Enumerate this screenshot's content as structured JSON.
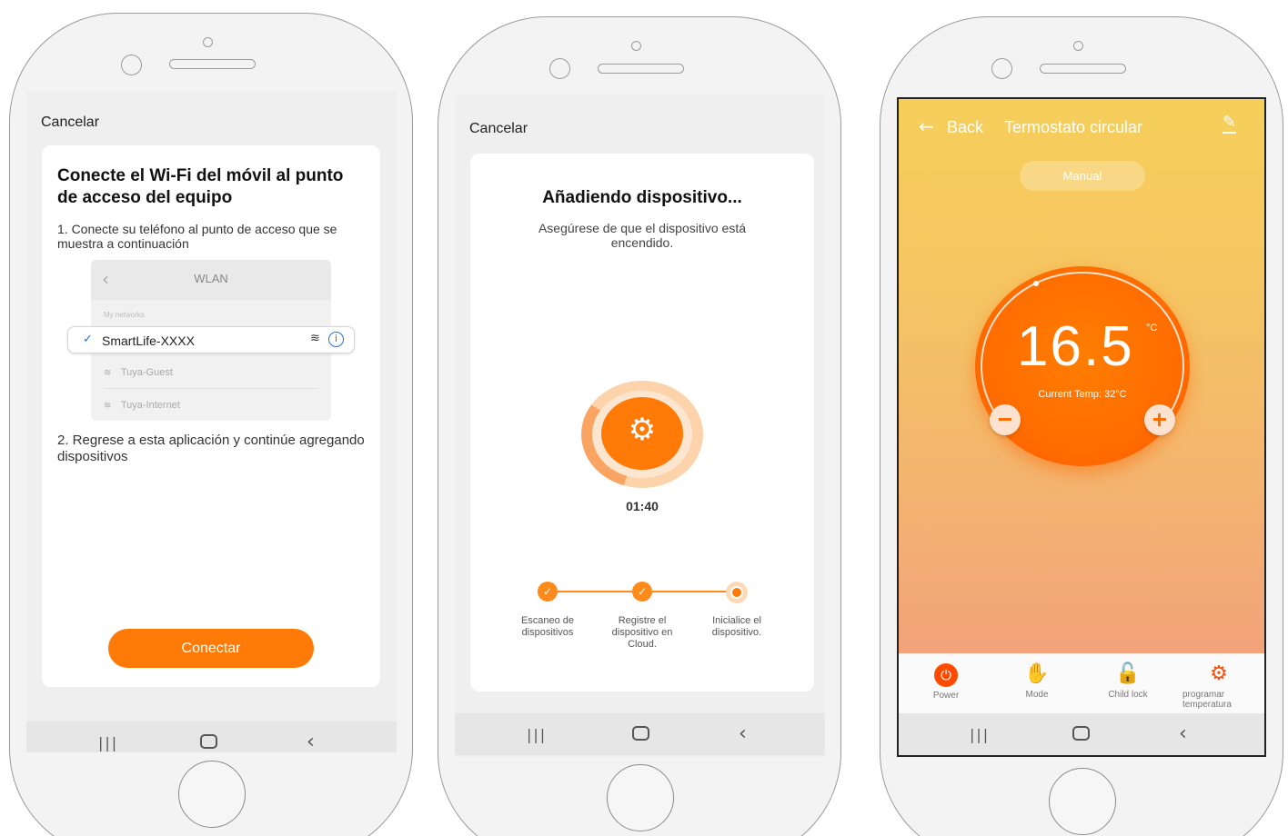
{
  "screen1": {
    "cancel_label": "Cancelar",
    "title": "Conecte el Wi-Fi del móvil al punto de acceso del equipo",
    "step1": "1. Conecte su teléfono al punto de acceso que se muestra a continuación",
    "wlan": {
      "title": "WLAN",
      "section_label": "My networks",
      "selected_network": "SmartLife-XXXX",
      "other_networks": [
        "Tuya-Guest",
        "Tuya-Internet"
      ]
    },
    "step2": "2. Regrese a esta aplicación y continúe agregando dispositivos",
    "connect_button": "Conectar"
  },
  "screen2": {
    "cancel_label": "Cancelar",
    "title": "Añadiendo dispositivo...",
    "subtitle": "Asegúrese de que el dispositivo está encendido.",
    "timer": "01:40",
    "steps": [
      {
        "label": "Escaneo de dispositivos",
        "state": "done"
      },
      {
        "label": "Registre el dispositivo en Cloud.",
        "state": "done"
      },
      {
        "label": "Inicialice el dispositivo.",
        "state": "active"
      }
    ]
  },
  "screen3": {
    "back_label": "Back",
    "title": "Termostato circular",
    "mode_badge": "Manual",
    "set_temp": "16.5",
    "unit": "°C",
    "current_temp": "Current Temp:  32°C",
    "toolbar": {
      "power": "Power",
      "mode": "Mode",
      "child_lock": "Child lock",
      "schedule": "programar temperatura"
    }
  },
  "colors": {
    "accent": "#ff7a06",
    "thermostat_dial": "#ff6d00",
    "thermostat_bg_top": "#f6cf5a",
    "thermostat_bg_bottom": "#f3a27a"
  },
  "icons": {
    "nav": [
      "recent-apps-icon",
      "home-icon",
      "back-icon"
    ],
    "wifi": "wifi-icon",
    "info": "info-icon",
    "gear": "gear-icon",
    "edit": "edit-icon",
    "power": "power-icon",
    "mode": "hand-icon",
    "lock": "lock-open-icon"
  }
}
